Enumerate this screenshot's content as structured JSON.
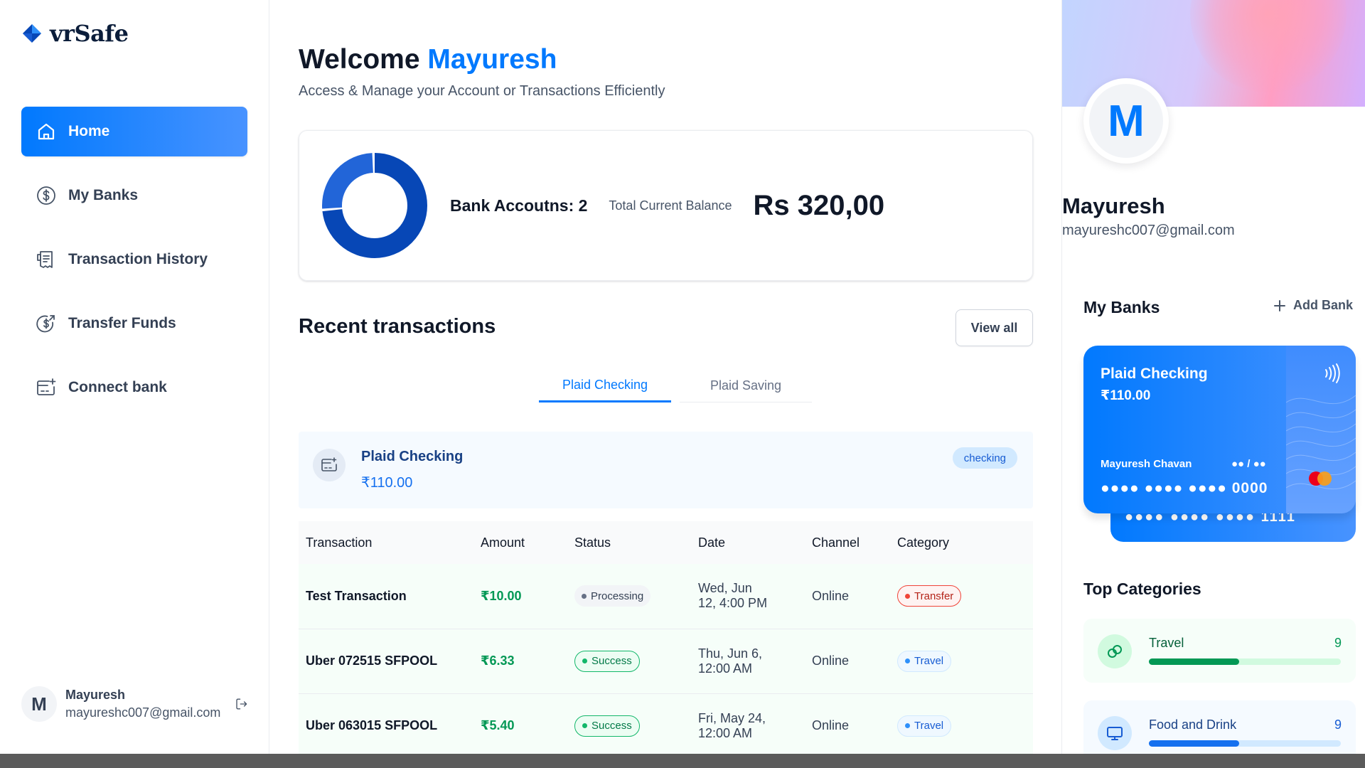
{
  "app": {
    "brand": "vrSafe"
  },
  "sidebar": {
    "items": [
      {
        "label": "Home",
        "icon": "home-icon",
        "active": true
      },
      {
        "label": "My Banks",
        "icon": "dollar-circle-icon",
        "active": false
      },
      {
        "label": "Transaction History",
        "icon": "receipt-icon",
        "active": false
      },
      {
        "label": "Transfer Funds",
        "icon": "money-send-icon",
        "active": false
      },
      {
        "label": "Connect bank",
        "icon": "card-add-icon",
        "active": false
      }
    ],
    "footer": {
      "initial": "M",
      "name": "Mayuresh",
      "email": "mayureshc007@gmail.com",
      "icon": "logout-icon"
    }
  },
  "header": {
    "greeting": "Welcome",
    "user": "Mayuresh",
    "subtitle": "Access & Manage your Account or Transactions Efficiently"
  },
  "balance": {
    "accounts_label": "Bank Accoutns: 2",
    "total_label": "Total Current Balance",
    "total_value": "Rs 320,00",
    "donut_shares": [
      0.74,
      0.26
    ]
  },
  "recent": {
    "title": "Recent transactions",
    "view_all": "View all",
    "tabs": [
      {
        "label": "Plaid Checking",
        "active": true
      },
      {
        "label": "Plaid Saving",
        "active": false
      }
    ],
    "account": {
      "name": "Plaid Checking",
      "amount": "₹110.00",
      "type": "checking"
    },
    "columns": [
      "Transaction",
      "Amount",
      "Status",
      "Date",
      "Channel",
      "Category"
    ],
    "rows": [
      {
        "name": "Test Transaction",
        "amount": "₹10.00",
        "status": "Processing",
        "date_line1": "Wed, Jun",
        "date_line2": "12, 4:00 PM",
        "channel": "Online",
        "category": "Transfer"
      },
      {
        "name": "Uber 072515 SFPOOL",
        "amount": "₹6.33",
        "status": "Success",
        "date_line1": "Thu, Jun 6,",
        "date_line2": "12:00 AM",
        "channel": "Online",
        "category": "Travel"
      },
      {
        "name": "Uber 063015 SFPOOL",
        "amount": "₹5.40",
        "status": "Success",
        "date_line1": "Fri, May 24,",
        "date_line2": "12:00 AM",
        "channel": "Online",
        "category": "Travel"
      }
    ]
  },
  "profile": {
    "initial": "M",
    "name": "Mayuresh",
    "email": "mayureshc007@gmail.com"
  },
  "my_banks": {
    "title": "My Banks",
    "add_label": "Add Bank",
    "card": {
      "bank": "Plaid Checking",
      "balance": "₹110.00",
      "holder": "Mayuresh Chavan",
      "expiry": "●● / ●●",
      "number": "●●●● ●●●● ●●●● 0000"
    },
    "back_card": {
      "number": "●●●● ●●●● ●●●● 1111"
    }
  },
  "top_categories": {
    "title": "Top Categories",
    "items": [
      {
        "name": "Travel",
        "count": "9",
        "progress": 0.47
      },
      {
        "name": "Food and Drink",
        "count": "9",
        "progress": 0.47
      }
    ]
  },
  "colors": {
    "accent": "#0179fe",
    "donut_primary": "#0747b6",
    "donut_secondary": "#2265d8",
    "success": "#039855",
    "danger": "#f04438"
  }
}
